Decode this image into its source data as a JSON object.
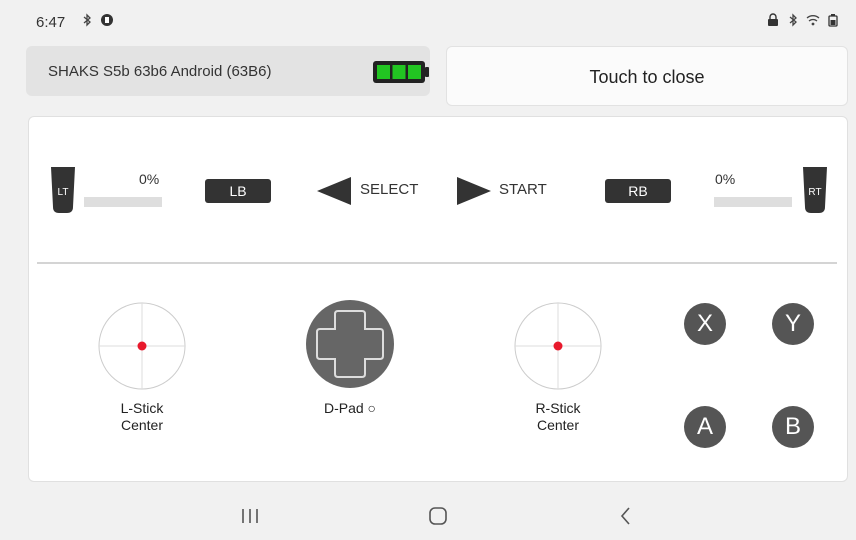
{
  "status_bar": {
    "time": "6:47",
    "left_icons": [
      "bluetooth-icon",
      "app-notification-icon"
    ],
    "right_icons": [
      "lock-icon",
      "bluetooth-icon",
      "wifi-icon",
      "battery-icon"
    ]
  },
  "device": {
    "name": "SHAKS S5b 63b6 Android (63B6)",
    "battery_level": 1.0,
    "battery_color": "#22c522"
  },
  "close_button": {
    "label": "Touch to close"
  },
  "controls": {
    "lt": {
      "label": "LT",
      "value": "0%",
      "level": 0
    },
    "rt": {
      "label": "RT",
      "value": "0%",
      "level": 0
    },
    "lb": "LB",
    "rb": "RB",
    "select": "SELECT",
    "start": "START"
  },
  "sticks": {
    "left": {
      "line1": "L-Stick",
      "line2": "Center"
    },
    "right": {
      "line1": "R-Stick",
      "line2": "Center"
    },
    "dot_color": "#e8192c"
  },
  "dpad": {
    "label": "D-Pad ○"
  },
  "face_buttons": {
    "x": "X",
    "y": "Y",
    "a": "A",
    "b": "B"
  },
  "navbar": {
    "icons": [
      "recent-apps-icon",
      "home-icon",
      "back-icon"
    ]
  }
}
